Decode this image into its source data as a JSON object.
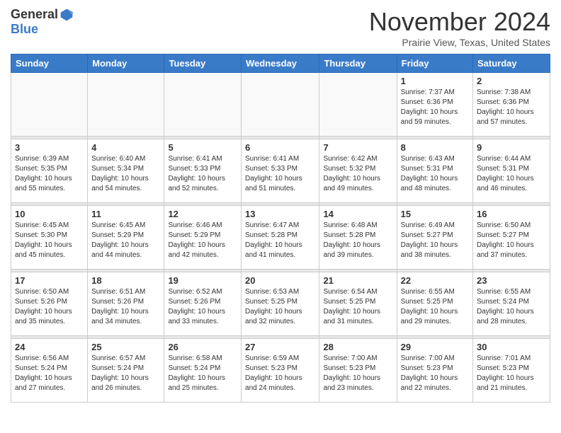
{
  "logo": {
    "general": "General",
    "blue": "Blue"
  },
  "header": {
    "month": "November 2024",
    "location": "Prairie View, Texas, United States"
  },
  "weekdays": [
    "Sunday",
    "Monday",
    "Tuesday",
    "Wednesday",
    "Thursday",
    "Friday",
    "Saturday"
  ],
  "weeks": [
    [
      {
        "day": "",
        "info": ""
      },
      {
        "day": "",
        "info": ""
      },
      {
        "day": "",
        "info": ""
      },
      {
        "day": "",
        "info": ""
      },
      {
        "day": "",
        "info": ""
      },
      {
        "day": "1",
        "info": "Sunrise: 7:37 AM\nSunset: 6:36 PM\nDaylight: 10 hours and 59 minutes."
      },
      {
        "day": "2",
        "info": "Sunrise: 7:38 AM\nSunset: 6:36 PM\nDaylight: 10 hours and 57 minutes."
      }
    ],
    [
      {
        "day": "3",
        "info": "Sunrise: 6:39 AM\nSunset: 5:35 PM\nDaylight: 10 hours and 55 minutes."
      },
      {
        "day": "4",
        "info": "Sunrise: 6:40 AM\nSunset: 5:34 PM\nDaylight: 10 hours and 54 minutes."
      },
      {
        "day": "5",
        "info": "Sunrise: 6:41 AM\nSunset: 5:33 PM\nDaylight: 10 hours and 52 minutes."
      },
      {
        "day": "6",
        "info": "Sunrise: 6:41 AM\nSunset: 5:33 PM\nDaylight: 10 hours and 51 minutes."
      },
      {
        "day": "7",
        "info": "Sunrise: 6:42 AM\nSunset: 5:32 PM\nDaylight: 10 hours and 49 minutes."
      },
      {
        "day": "8",
        "info": "Sunrise: 6:43 AM\nSunset: 5:31 PM\nDaylight: 10 hours and 48 minutes."
      },
      {
        "day": "9",
        "info": "Sunrise: 6:44 AM\nSunset: 5:31 PM\nDaylight: 10 hours and 46 minutes."
      }
    ],
    [
      {
        "day": "10",
        "info": "Sunrise: 6:45 AM\nSunset: 5:30 PM\nDaylight: 10 hours and 45 minutes."
      },
      {
        "day": "11",
        "info": "Sunrise: 6:45 AM\nSunset: 5:29 PM\nDaylight: 10 hours and 44 minutes."
      },
      {
        "day": "12",
        "info": "Sunrise: 6:46 AM\nSunset: 5:29 PM\nDaylight: 10 hours and 42 minutes."
      },
      {
        "day": "13",
        "info": "Sunrise: 6:47 AM\nSunset: 5:28 PM\nDaylight: 10 hours and 41 minutes."
      },
      {
        "day": "14",
        "info": "Sunrise: 6:48 AM\nSunset: 5:28 PM\nDaylight: 10 hours and 39 minutes."
      },
      {
        "day": "15",
        "info": "Sunrise: 6:49 AM\nSunset: 5:27 PM\nDaylight: 10 hours and 38 minutes."
      },
      {
        "day": "16",
        "info": "Sunrise: 6:50 AM\nSunset: 5:27 PM\nDaylight: 10 hours and 37 minutes."
      }
    ],
    [
      {
        "day": "17",
        "info": "Sunrise: 6:50 AM\nSunset: 5:26 PM\nDaylight: 10 hours and 35 minutes."
      },
      {
        "day": "18",
        "info": "Sunrise: 6:51 AM\nSunset: 5:26 PM\nDaylight: 10 hours and 34 minutes."
      },
      {
        "day": "19",
        "info": "Sunrise: 6:52 AM\nSunset: 5:26 PM\nDaylight: 10 hours and 33 minutes."
      },
      {
        "day": "20",
        "info": "Sunrise: 6:53 AM\nSunset: 5:25 PM\nDaylight: 10 hours and 32 minutes."
      },
      {
        "day": "21",
        "info": "Sunrise: 6:54 AM\nSunset: 5:25 PM\nDaylight: 10 hours and 31 minutes."
      },
      {
        "day": "22",
        "info": "Sunrise: 6:55 AM\nSunset: 5:25 PM\nDaylight: 10 hours and 29 minutes."
      },
      {
        "day": "23",
        "info": "Sunrise: 6:55 AM\nSunset: 5:24 PM\nDaylight: 10 hours and 28 minutes."
      }
    ],
    [
      {
        "day": "24",
        "info": "Sunrise: 6:56 AM\nSunset: 5:24 PM\nDaylight: 10 hours and 27 minutes."
      },
      {
        "day": "25",
        "info": "Sunrise: 6:57 AM\nSunset: 5:24 PM\nDaylight: 10 hours and 26 minutes."
      },
      {
        "day": "26",
        "info": "Sunrise: 6:58 AM\nSunset: 5:24 PM\nDaylight: 10 hours and 25 minutes."
      },
      {
        "day": "27",
        "info": "Sunrise: 6:59 AM\nSunset: 5:23 PM\nDaylight: 10 hours and 24 minutes."
      },
      {
        "day": "28",
        "info": "Sunrise: 7:00 AM\nSunset: 5:23 PM\nDaylight: 10 hours and 23 minutes."
      },
      {
        "day": "29",
        "info": "Sunrise: 7:00 AM\nSunset: 5:23 PM\nDaylight: 10 hours and 22 minutes."
      },
      {
        "day": "30",
        "info": "Sunrise: 7:01 AM\nSunset: 5:23 PM\nDaylight: 10 hours and 21 minutes."
      }
    ]
  ]
}
